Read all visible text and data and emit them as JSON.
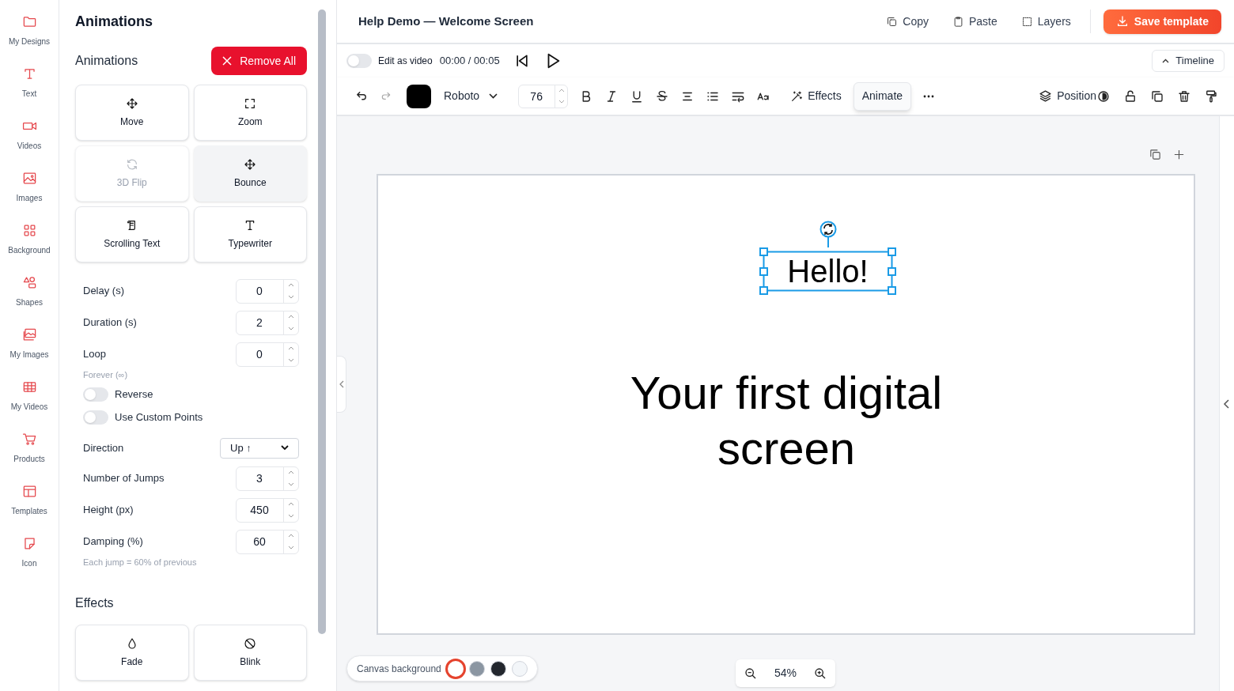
{
  "sidebar": {
    "items": [
      {
        "label": "My Designs"
      },
      {
        "label": "Text"
      },
      {
        "label": "Videos"
      },
      {
        "label": "Images"
      },
      {
        "label": "Background"
      },
      {
        "label": "Shapes"
      },
      {
        "label": "My Images"
      },
      {
        "label": "My Videos"
      },
      {
        "label": "Products"
      },
      {
        "label": "Templates"
      },
      {
        "label": "Icon"
      }
    ]
  },
  "panel": {
    "title": "Animations",
    "section_title": "Animations",
    "remove_button": "Remove All",
    "animations": [
      {
        "label": "Move",
        "disabled": false,
        "selected": false
      },
      {
        "label": "Zoom",
        "disabled": false,
        "selected": false
      },
      {
        "label": "3D Flip",
        "disabled": true,
        "selected": false
      },
      {
        "label": "Bounce",
        "disabled": false,
        "selected": true
      },
      {
        "label": "Scrolling Text",
        "disabled": false,
        "selected": false
      },
      {
        "label": "Typewriter",
        "disabled": false,
        "selected": false
      }
    ],
    "settings": [
      {
        "kind": "number",
        "label": "Delay (s)",
        "value": "0"
      },
      {
        "kind": "number",
        "label": "Duration (s)",
        "value": "2"
      },
      {
        "kind": "number",
        "label": "Loop",
        "value": "0"
      },
      {
        "kind": "hint",
        "label": "Forever (∞)"
      },
      {
        "kind": "toggle",
        "label": "Reverse",
        "on": false
      },
      {
        "kind": "toggle",
        "label": "Use Custom Points",
        "on": false
      },
      {
        "kind": "select",
        "label": "Direction",
        "value": "Up ↑"
      },
      {
        "kind": "number",
        "label": "Number of Jumps",
        "value": "3"
      },
      {
        "kind": "number",
        "label": "Height (px)",
        "value": "450"
      },
      {
        "kind": "number",
        "label": "Damping (%)",
        "value": "60"
      },
      {
        "kind": "hint",
        "label": "Each jump = 60% of previous"
      }
    ],
    "effects_title": "Effects",
    "effects": [
      {
        "label": "Fade"
      },
      {
        "label": "Blink"
      }
    ]
  },
  "header": {
    "title": "Help Demo — Welcome Screen",
    "actions": [
      {
        "label": "Copy"
      },
      {
        "label": "Paste"
      },
      {
        "label": "Layers"
      }
    ],
    "save_button": "Save template"
  },
  "playback": {
    "edit_as_video": {
      "label": "Edit as video",
      "on": false
    },
    "time": "00:00 / 00:05",
    "timeline_button": "Timeline"
  },
  "toolbar": {
    "font": "Roboto",
    "font_size": "76",
    "tools": [
      {
        "label": "Effects",
        "selected": false
      },
      {
        "label": "Animate",
        "selected": true
      }
    ],
    "position_button": "Position"
  },
  "canvas": {
    "elements": [
      {
        "text": "Hello!",
        "kind": "small",
        "selected": true
      },
      {
        "text": "Your first digital screen",
        "kind": "large",
        "selected": false
      }
    ]
  },
  "canvas_background": {
    "label": "Canvas background",
    "swatches": [
      {
        "color": "#ffffff",
        "selected": true
      },
      {
        "color": "#8b96a2",
        "selected": false
      },
      {
        "color": "#23272e",
        "selected": false
      },
      {
        "color": "#f3f6f9",
        "selected": false
      }
    ]
  },
  "zoom": {
    "value": "54%"
  }
}
